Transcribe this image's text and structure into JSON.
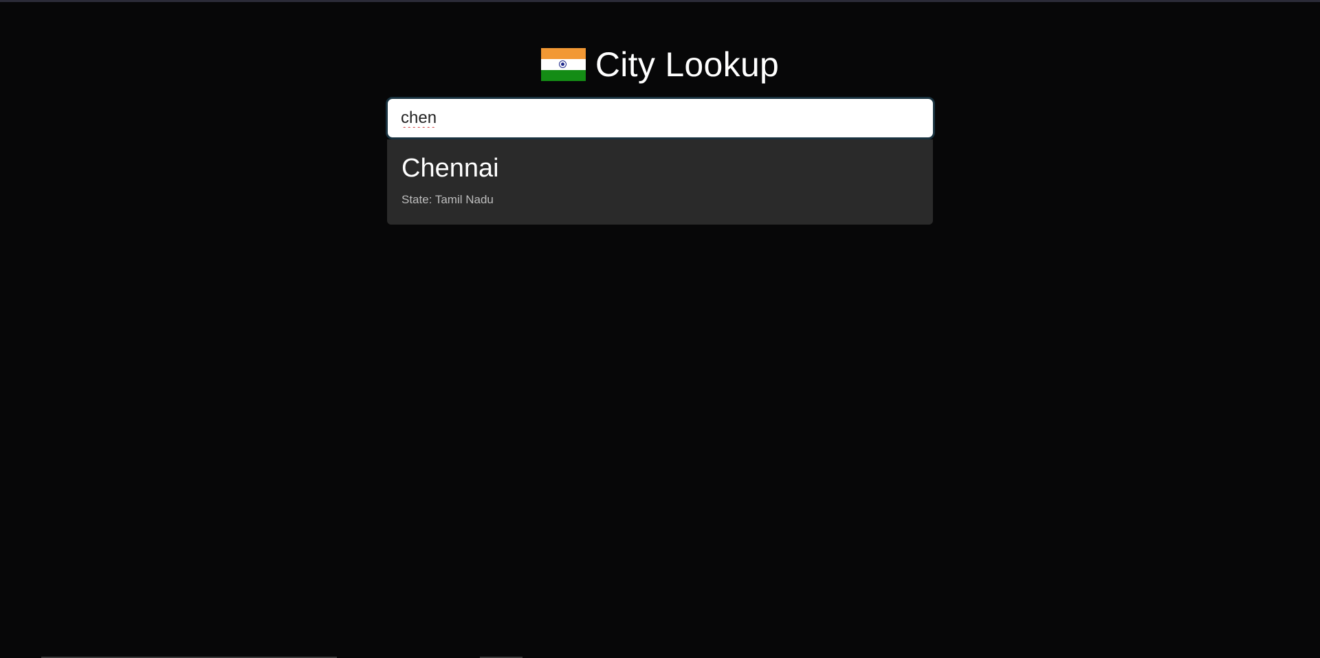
{
  "header": {
    "flag_icon": "india-flag-icon",
    "title": "City Lookup"
  },
  "search": {
    "value": "chen"
  },
  "results": [
    {
      "city": "Chennai",
      "state_text": "State: Tamil Nadu"
    }
  ],
  "colors": {
    "background": "#070708",
    "input_border": "#19323f",
    "result_background": "#2a2a2a",
    "flag_saffron": "#f29834",
    "flag_green": "#148c15",
    "flag_chakra": "#1f2a8a"
  }
}
